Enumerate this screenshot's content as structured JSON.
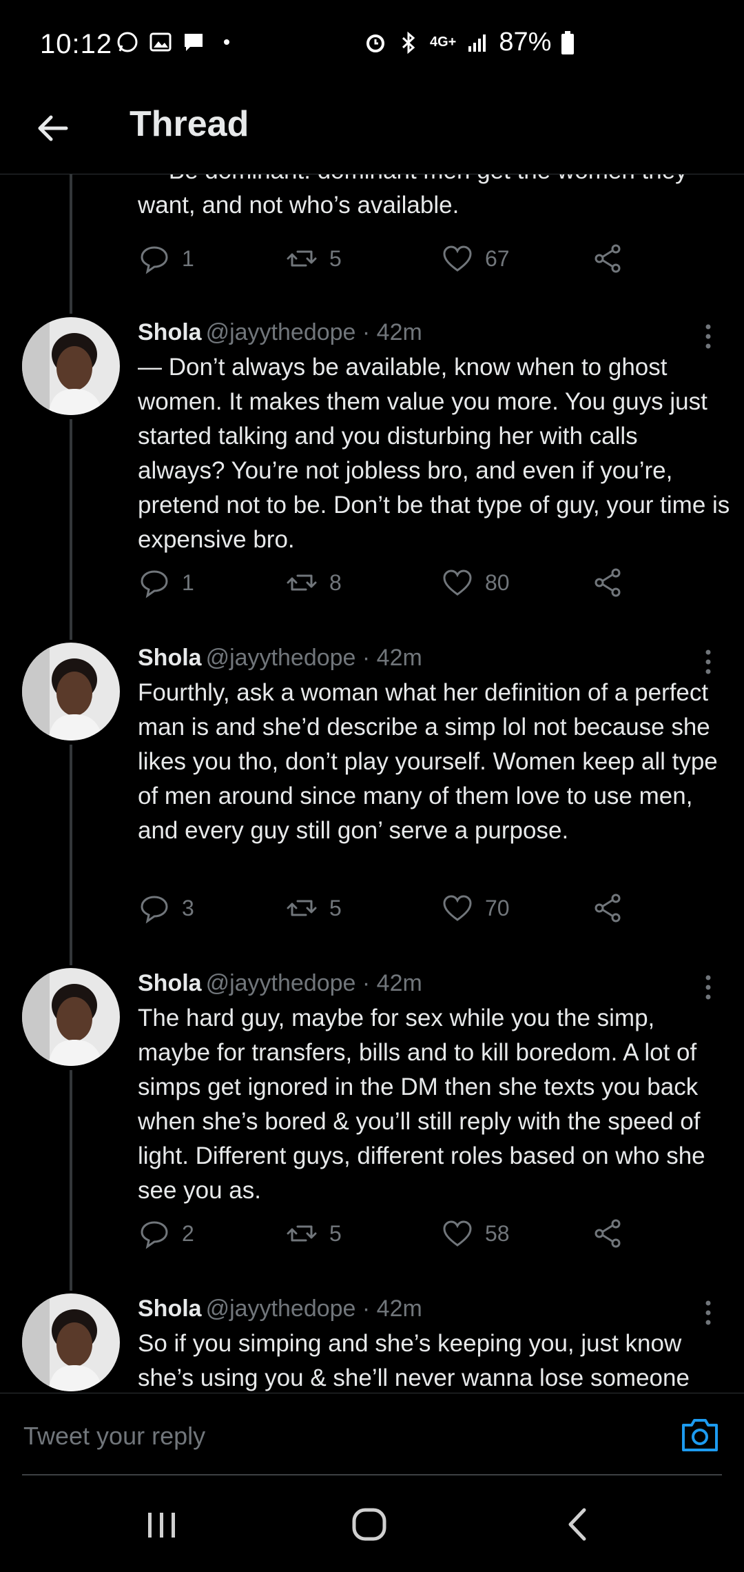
{
  "status_bar": {
    "time": "10:12",
    "battery": "87%",
    "network": "4G+"
  },
  "header": {
    "title": "Thread"
  },
  "partial_tweet": {
    "text": "— Be dominant: dominant men get the women they want, and not who’s available.",
    "replies": "1",
    "retweets": "5",
    "likes": "67"
  },
  "tweets": [
    {
      "name": "Shola",
      "handle": "@jayythedope · 42m",
      "text": "— Don’t always be available, know when to ghost women. It makes them value you more. You guys just started talking and you disturbing her with calls always? You’re not jobless bro, and even if you’re, pretend not to be. Don’t be that type of guy, your time is expensive bro.",
      "replies": "1",
      "retweets": "8",
      "likes": "80"
    },
    {
      "name": "Shola",
      "handle": "@jayythedope · 42m",
      "text": "Fourthly, ask a woman what her definition of a perfect man is and she’d describe a simp lol not because she likes you tho, don’t play yourself. Women keep all type of men around since many of them love to use men, and every guy still gon’ serve a purpose.",
      "replies": "3",
      "retweets": "5",
      "likes": "70"
    },
    {
      "name": "Shola",
      "handle": "@jayythedope · 42m",
      "text": "The hard guy, maybe for sex while you the simp, maybe for transfers, bills and to kill boredom. A lot of simps get ignored in the DM then she texts you back when she’s bored & you’ll still reply with the speed of light. Different guys, different roles based on who she see you as.",
      "replies": "2",
      "retweets": "5",
      "likes": "58"
    },
    {
      "name": "Shola",
      "handle": "@jayythedope · 42m",
      "text": "So if you simping and she’s keeping you, just know she’s using you & she’ll never wanna lose someone"
    }
  ],
  "reply_bar": {
    "placeholder": "Tweet your reply"
  },
  "colors": {
    "background": "#000000",
    "text": "#e7e9ea",
    "secondary": "#71767b",
    "accent": "#1d9bf0"
  }
}
